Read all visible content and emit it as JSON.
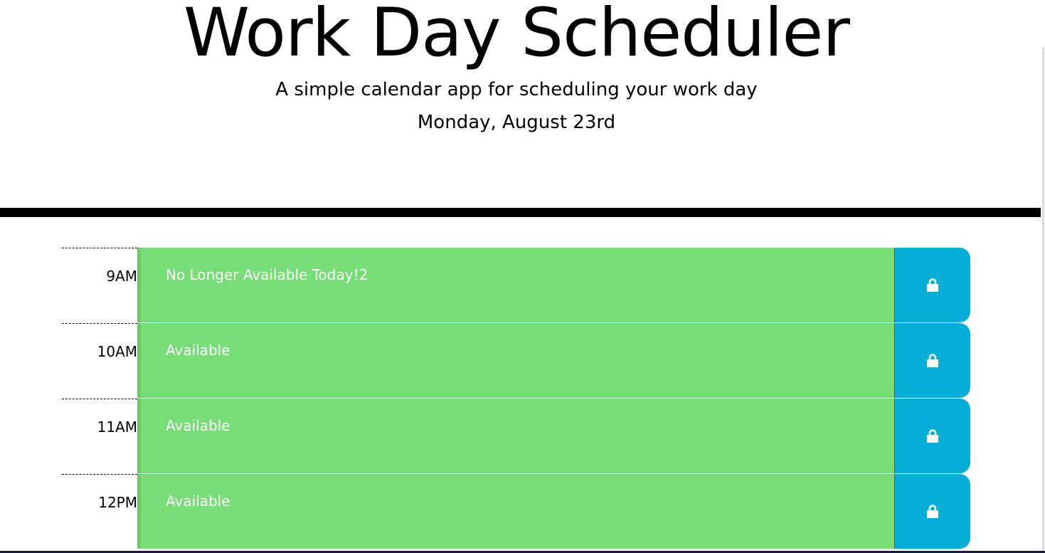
{
  "header": {
    "title": "Work Day Scheduler",
    "subtitle": "A simple calendar app for scheduling your work day",
    "current_day": "Monday, August 23rd"
  },
  "colors": {
    "divider": "#000000",
    "future": "#77dd77",
    "save_button": "#06aed5",
    "text_on_block": "#ffffff"
  },
  "time_blocks": [
    {
      "hour": "9AM",
      "text": "No Longer Available Today!2",
      "save_icon": "lock-icon"
    },
    {
      "hour": "10AM",
      "text": "Available",
      "save_icon": "lock-icon"
    },
    {
      "hour": "11AM",
      "text": "Available",
      "save_icon": "lock-icon"
    },
    {
      "hour": "12PM",
      "text": "Available",
      "save_icon": "lock-icon"
    }
  ]
}
